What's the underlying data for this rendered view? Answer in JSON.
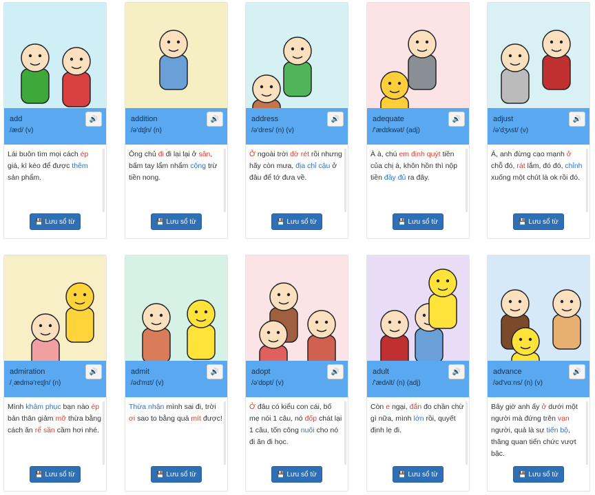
{
  "save_label": "Lưu sổ từ",
  "icons": {
    "speaker": "speaker-icon",
    "save": "floppy-disk-icon"
  },
  "colors": {
    "info_bar": "#5aa8f0",
    "save_button": "#2f6fb5",
    "highlight_red": "#e03a2a",
    "highlight_blue": "#2b71c4"
  },
  "cards": [
    {
      "word": "add",
      "ipa": "/æd/ (v)",
      "bg": "#cfeef5",
      "desc": [
        [
          "Lái buôn tìm mọi cách ",
          ""
        ],
        [
          "ép",
          "r"
        ],
        [
          " giá, kì kèo để được ",
          ""
        ],
        [
          "thêm",
          "b"
        ],
        [
          " sản phẩm.",
          ""
        ]
      ]
    },
    {
      "word": "addition",
      "ipa": "/ə'dɪʃn/ (n)",
      "bg": "#f7efc4",
      "desc": [
        [
          "Ông chủ ",
          ""
        ],
        [
          "đi",
          "r"
        ],
        [
          " đi lại lại ở ",
          ""
        ],
        [
          "sân",
          "r"
        ],
        [
          ", bấm tay lẩm nhẩm ",
          ""
        ],
        [
          "cộng",
          "b"
        ],
        [
          " trừ tiền nong.",
          ""
        ]
      ]
    },
    {
      "word": "address",
      "ipa": "/ə'dres/ (n) (v)",
      "bg": "#d6f1f3",
      "desc": [
        [
          "Ở",
          "r"
        ],
        [
          " ngoài trời ",
          ""
        ],
        [
          "đờ rét",
          "r"
        ],
        [
          " rồi nhưng hãy còn mưa, ",
          ""
        ],
        [
          "địa chỉ cậu",
          "b"
        ],
        [
          " ở đâu để tớ đưa về.",
          ""
        ]
      ]
    },
    {
      "word": "adequate",
      "ipa": "/'ædɪkwət/ (adj)",
      "bg": "#fbe3e6",
      "desc": [
        [
          "À à, chú ",
          ""
        ],
        [
          "em định quýt",
          "r"
        ],
        [
          " tiền của chị à, khôn hồn thì nộp tiền ",
          ""
        ],
        [
          "đầy đủ",
          "b"
        ],
        [
          " ra đây.",
          ""
        ]
      ]
    },
    {
      "word": "adjust",
      "ipa": "/ə'dʒʌst/ (v)",
      "bg": "#d9f1f4",
      "desc": [
        [
          "Á, anh đừng cạo mạnh ",
          ""
        ],
        [
          "ở",
          "r"
        ],
        [
          " chỗ đó, ",
          ""
        ],
        [
          "rát",
          "r"
        ],
        [
          " lắm, đó đó, ",
          ""
        ],
        [
          "chỉnh",
          "b"
        ],
        [
          " xuống một chút là ok rồi đó.",
          ""
        ]
      ]
    },
    {
      "word": "admiration",
      "ipa": "/ˌædmə'reɪʃn/ (n)",
      "bg": "#f8efc6",
      "desc": [
        [
          "Mình ",
          ""
        ],
        [
          "khâm phục",
          "b"
        ],
        [
          " bạn nào ",
          ""
        ],
        [
          "ép",
          "r"
        ],
        [
          " bản thân giảm ",
          ""
        ],
        [
          "mỡ",
          "r"
        ],
        [
          " thừa bằng cách ăn ",
          ""
        ],
        [
          "rể sần",
          "r"
        ],
        [
          " cầm hơi nhé.",
          ""
        ]
      ]
    },
    {
      "word": "admit",
      "ipa": "/əd'mɪt/ (v)",
      "bg": "#d6f1e6",
      "desc": [
        [
          "Thừa nhận",
          "b"
        ],
        [
          " mình sai đi, trời ",
          ""
        ],
        [
          "ơi",
          "r"
        ],
        [
          " sao to bằng quả ",
          ""
        ],
        [
          "mít",
          "r"
        ],
        [
          " được!",
          ""
        ]
      ]
    },
    {
      "word": "adopt",
      "ipa": "/ə'dɒpt/ (v)",
      "bg": "#fbe3e6",
      "desc": [
        [
          "Ở",
          "r"
        ],
        [
          " đâu có kiểu con cái, bố mẹ nói 1 câu, nó ",
          ""
        ],
        [
          "đốp",
          "r"
        ],
        [
          " chát lại 1 câu, tốn công ",
          ""
        ],
        [
          "nuôi",
          "b"
        ],
        [
          " cho nó đi ăn đi học.",
          ""
        ]
      ]
    },
    {
      "word": "adult",
      "ipa": "/'ædʌlt/ (n) (adj)",
      "bg": "#e9dcf6",
      "desc": [
        [
          "Còn ",
          ""
        ],
        [
          "e",
          "r"
        ],
        [
          " ngại, ",
          ""
        ],
        [
          "đắn",
          "r"
        ],
        [
          " đo chần chừ gì nữa, mình ",
          ""
        ],
        [
          "lớn",
          "b"
        ],
        [
          " rồi, quyết định lẹ đi.",
          ""
        ]
      ]
    },
    {
      "word": "advance",
      "ipa": "/əd'vɑːns/ (n) (v)",
      "bg": "#d6e9f8",
      "desc": [
        [
          "Bây giờ anh ấy ",
          ""
        ],
        [
          "ở",
          "r"
        ],
        [
          " dưới một người mà đứng trên ",
          ""
        ],
        [
          "vạn",
          "r"
        ],
        [
          " người, quả là sự ",
          ""
        ],
        [
          "tiến bộ",
          "b"
        ],
        [
          ", thăng quan tiến chức vượt bậc.",
          ""
        ]
      ]
    }
  ]
}
